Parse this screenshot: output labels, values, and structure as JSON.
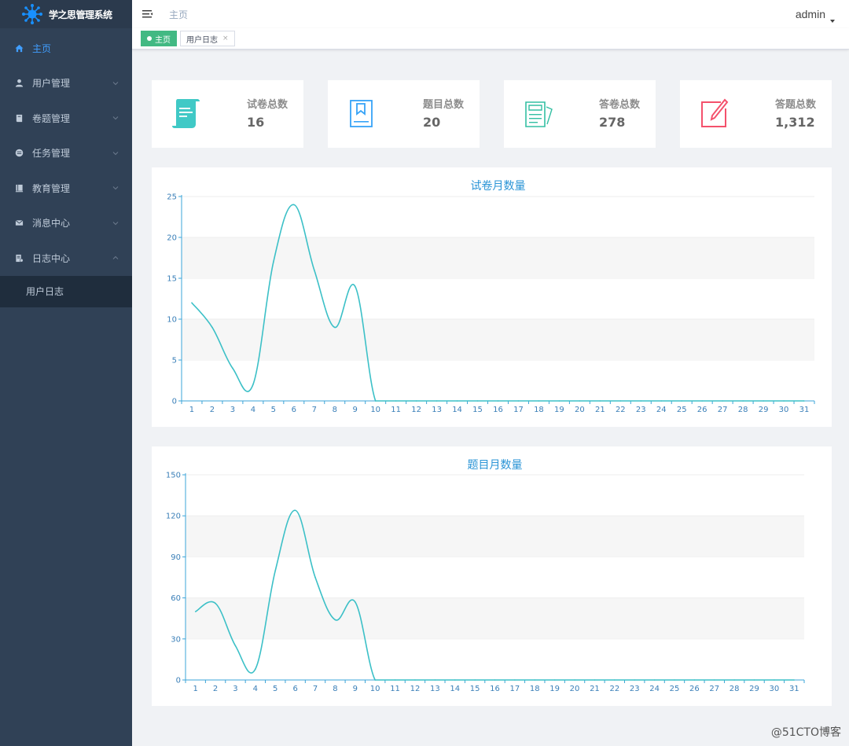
{
  "app": {
    "title": "学之思管理系统",
    "colors": {
      "sidebar": "#304156",
      "accent": "#409eff",
      "tag_active": "#42b983",
      "line": "#3cc0c7"
    }
  },
  "sidebar": {
    "items": [
      {
        "label": "主页",
        "icon": "home-icon",
        "active": true
      },
      {
        "label": "用户管理",
        "icon": "user-icon"
      },
      {
        "label": "卷题管理",
        "icon": "book-icon"
      },
      {
        "label": "任务管理",
        "icon": "task-icon"
      },
      {
        "label": "教育管理",
        "icon": "education-icon"
      },
      {
        "label": "消息中心",
        "icon": "mail-icon"
      },
      {
        "label": "日志中心",
        "icon": "log-icon",
        "expanded": true
      }
    ],
    "submenu": [
      {
        "label": "用户日志"
      }
    ]
  },
  "header": {
    "breadcrumb": "主页",
    "user": "admin"
  },
  "tags": [
    {
      "label": "主页",
      "active": true
    },
    {
      "label": "用户日志",
      "close": "×"
    }
  ],
  "stats": [
    {
      "label": "试卷总数",
      "value": "16",
      "icon": "scroll-icon",
      "color": "#40c9c6"
    },
    {
      "label": "题目总数",
      "value": "20",
      "icon": "bookmark-icon",
      "color": "#36a3f7"
    },
    {
      "label": "答卷总数",
      "value": "278",
      "icon": "papers-icon",
      "color": "#34bfa3"
    },
    {
      "label": "答题总数",
      "value": "1,312",
      "icon": "edit-icon",
      "color": "#f4516c"
    }
  ],
  "chart_data": [
    {
      "type": "line",
      "title": "试卷月数量",
      "categories": [
        "1",
        "2",
        "3",
        "4",
        "5",
        "6",
        "7",
        "8",
        "9",
        "10",
        "11",
        "12",
        "13",
        "14",
        "15",
        "16",
        "17",
        "18",
        "19",
        "20",
        "21",
        "22",
        "23",
        "24",
        "25",
        "26",
        "27",
        "28",
        "29",
        "30",
        "31"
      ],
      "values": [
        12,
        9,
        4,
        2,
        17,
        24,
        16,
        9,
        14,
        0,
        0,
        0,
        0,
        0,
        0,
        0,
        0,
        0,
        0,
        0,
        0,
        0,
        0,
        0,
        0,
        0,
        0,
        0,
        0,
        0,
        0
      ],
      "ylim": [
        0,
        25
      ],
      "yticks": [
        "0",
        "5",
        "10",
        "15",
        "20",
        "25"
      ],
      "smooth": true,
      "grid": "alternating-bands"
    },
    {
      "type": "line",
      "title": "题目月数量",
      "categories": [
        "1",
        "2",
        "3",
        "4",
        "5",
        "6",
        "7",
        "8",
        "9",
        "10",
        "11",
        "12",
        "13",
        "14",
        "15",
        "16",
        "17",
        "18",
        "19",
        "20",
        "21",
        "22",
        "23",
        "24",
        "25",
        "26",
        "27",
        "28",
        "29",
        "30",
        "31"
      ],
      "values": [
        50,
        56,
        25,
        8,
        80,
        124,
        75,
        44,
        57,
        0,
        0,
        0,
        0,
        0,
        0,
        0,
        0,
        0,
        0,
        0,
        0,
        0,
        0,
        0,
        0,
        0,
        0,
        0,
        0,
        0,
        0
      ],
      "ylim": [
        0,
        150
      ],
      "yticks": [
        "0",
        "30",
        "60",
        "90",
        "120",
        "150"
      ],
      "smooth": true,
      "grid": "alternating-bands"
    }
  ],
  "watermark": "@51CTO博客"
}
